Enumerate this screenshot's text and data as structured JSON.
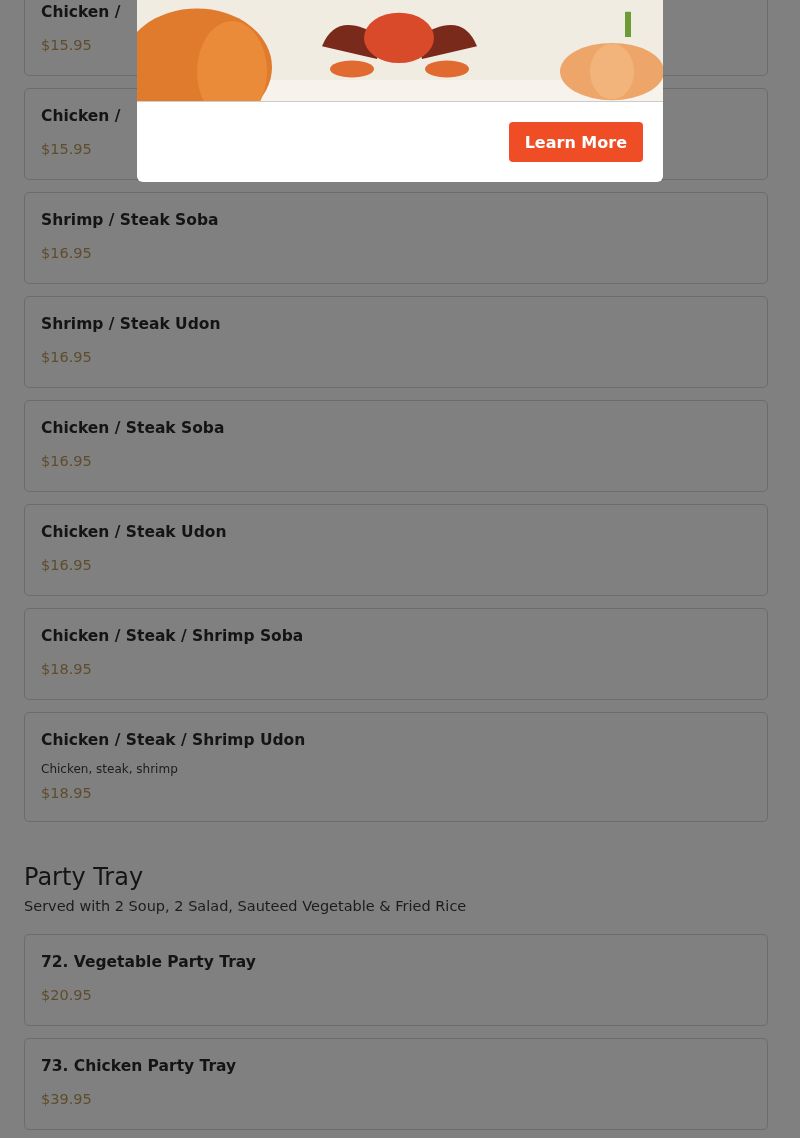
{
  "sections": [
    {
      "items": [
        {
          "name": "Chicken /",
          "price": "$15.95"
        },
        {
          "name": "Chicken /",
          "price": "$15.95"
        },
        {
          "name": "Shrimp / Steak Soba",
          "price": "$16.95"
        },
        {
          "name": "Shrimp / Steak Udon",
          "price": "$16.95"
        },
        {
          "name": "Chicken / Steak Soba",
          "price": "$16.95"
        },
        {
          "name": "Chicken / Steak Udon",
          "price": "$16.95"
        },
        {
          "name": "Chicken / Steak / Shrimp Soba",
          "price": "$18.95"
        },
        {
          "name": "Chicken / Steak / Shrimp Udon",
          "description": "Chicken, steak, shrimp",
          "price": "$18.95"
        }
      ]
    },
    {
      "title": "Party Tray",
      "subtitle": "Served with 2 Soup, 2 Salad, Sauteed Vegetable & Fried Rice",
      "items": [
        {
          "name": "72. Vegetable Party Tray",
          "price": "$20.95"
        },
        {
          "name": "73. Chicken Party Tray",
          "price": "$39.95"
        }
      ]
    }
  ],
  "modal": {
    "button": "Learn More"
  }
}
